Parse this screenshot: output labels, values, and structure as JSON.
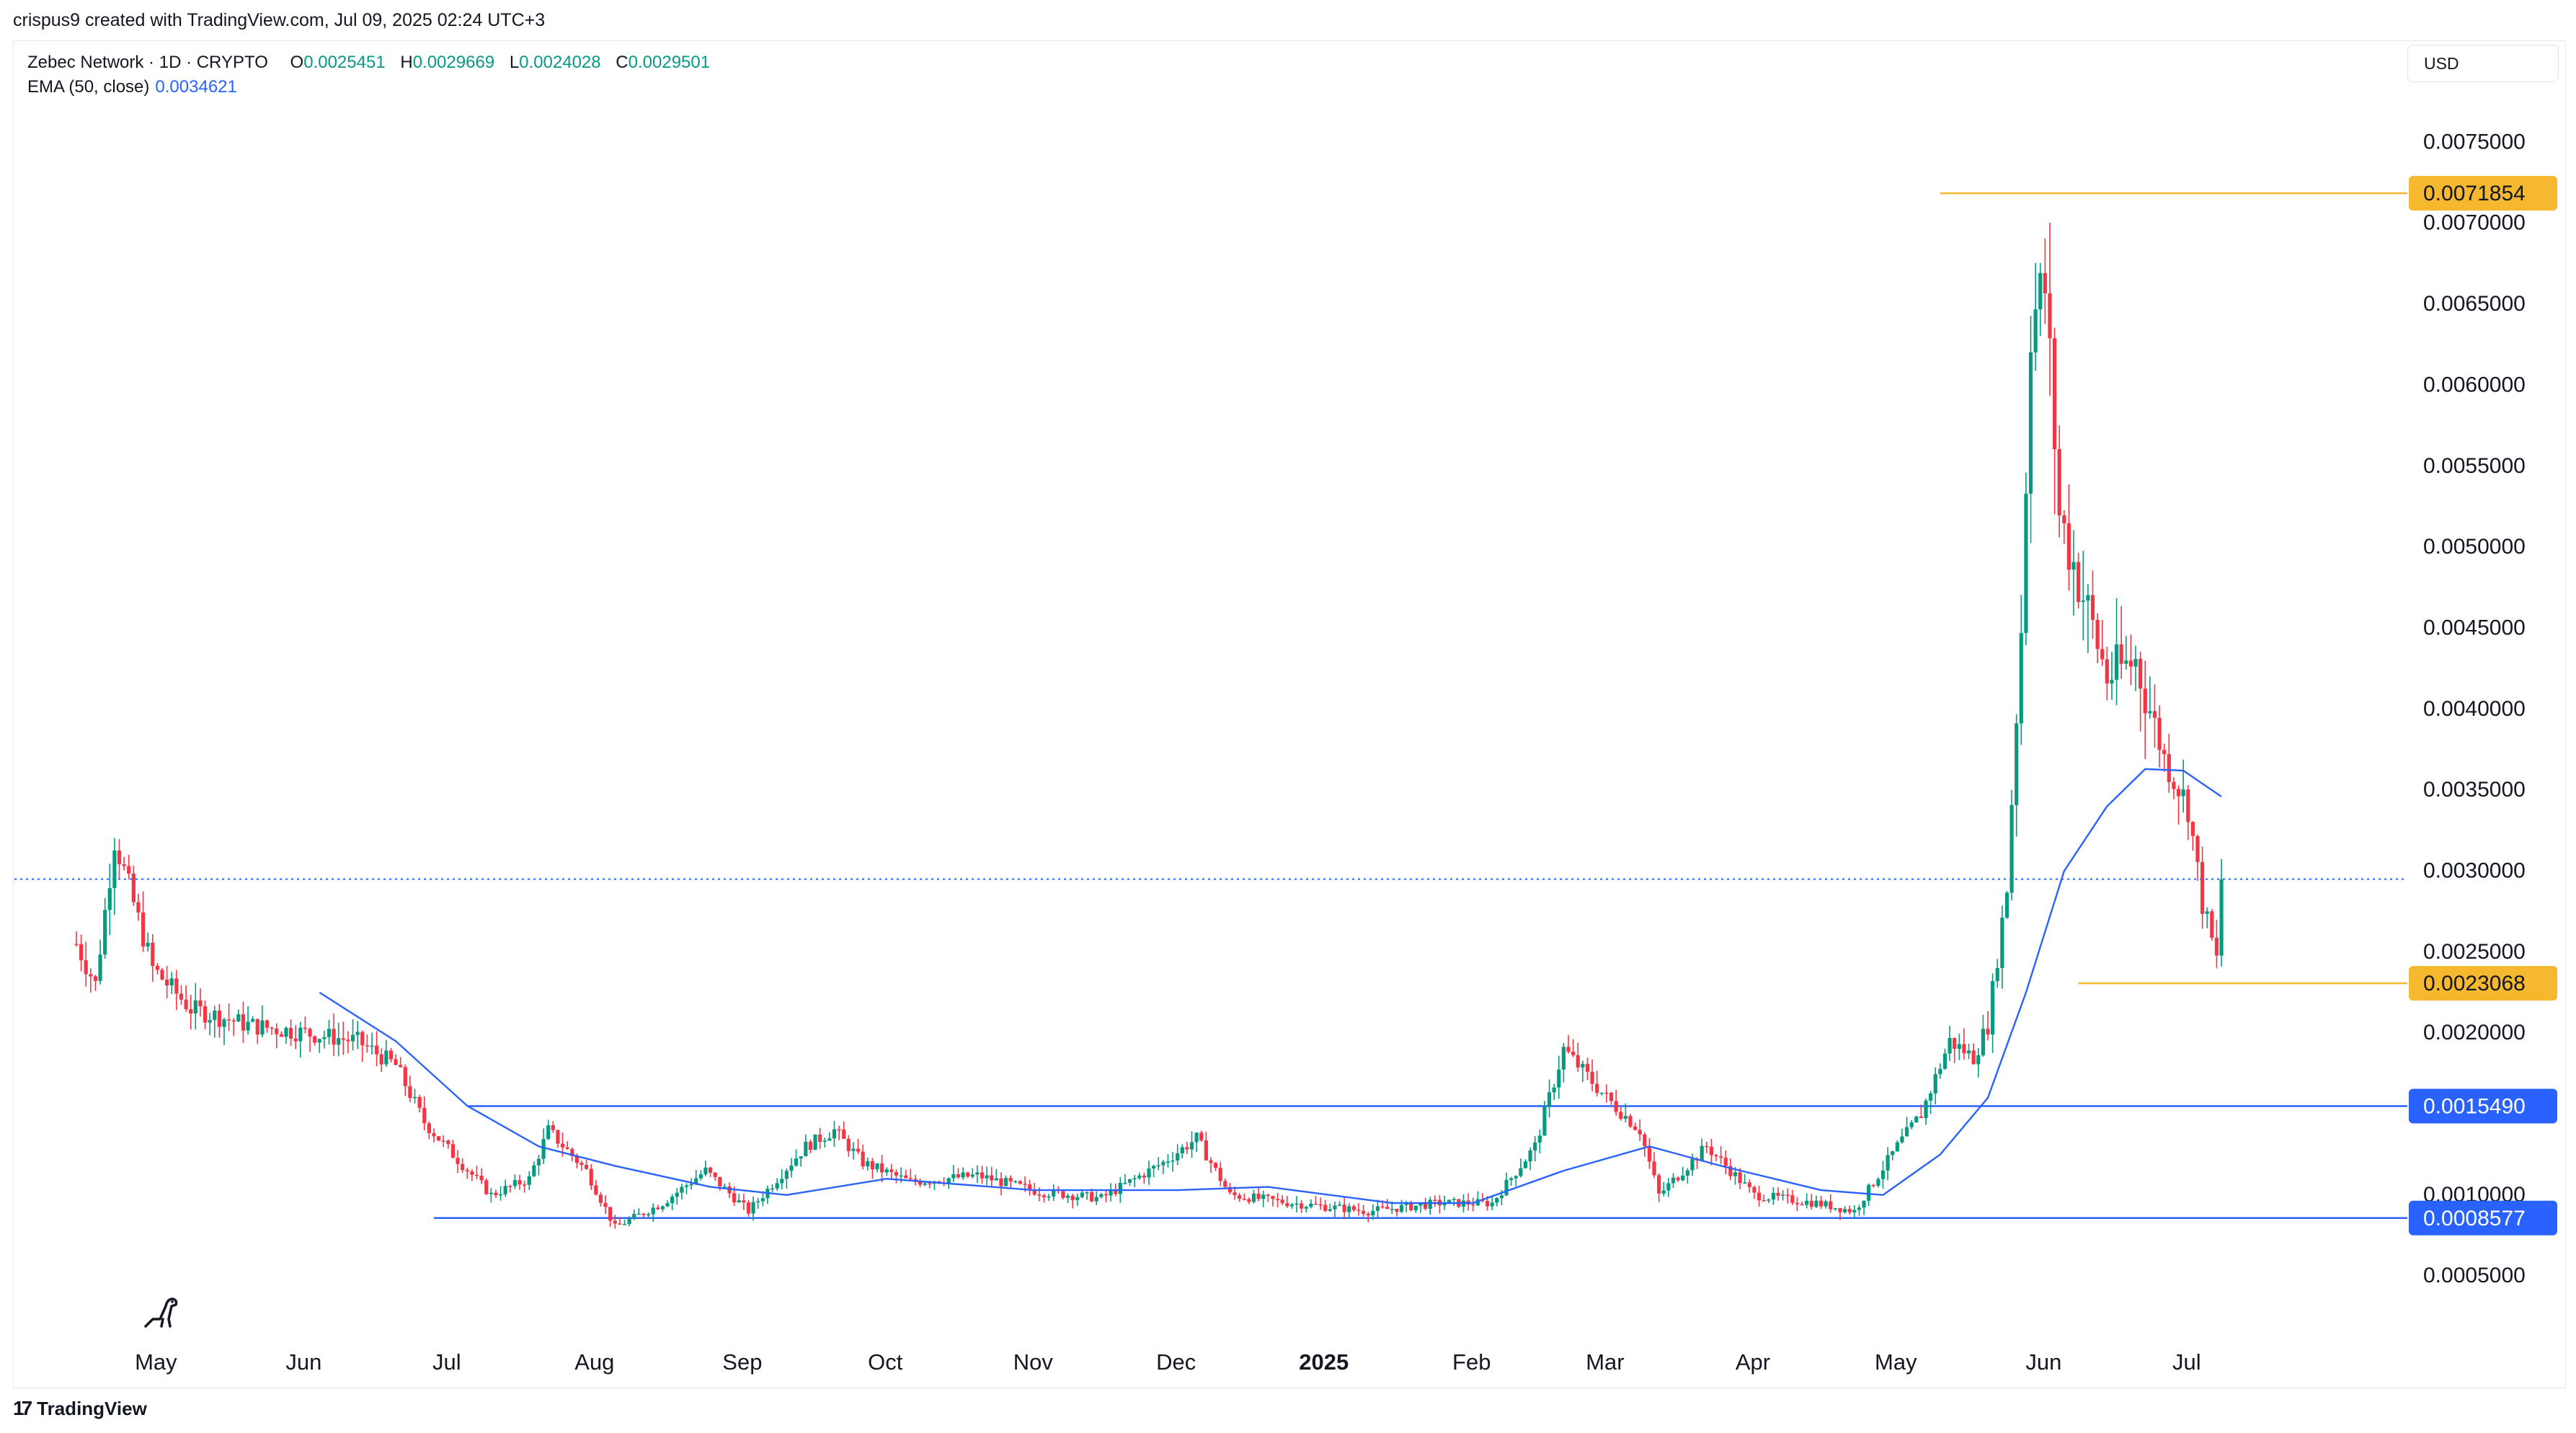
{
  "header": {
    "created_by": "crispus9 created with TradingView.com, Jul 09, 2025 02:24 UTC+3"
  },
  "legend": {
    "symbol": "Zebec Network · 1D · CRYPTO",
    "open_label": "O",
    "open": "0.0025451",
    "high_label": "H",
    "high": "0.0029669",
    "low_label": "L",
    "low": "0.0024028",
    "close_label": "C",
    "close": "0.0029501",
    "ema_label": "EMA (50, close)",
    "ema_value": "0.0034621"
  },
  "currency": "USD",
  "footer": {
    "brand": "TradingView",
    "brand_mark": "17"
  },
  "icons": {
    "dino": "dino-icon",
    "logo": "tradingview-logo-icon"
  },
  "colors": {
    "up": "#089981",
    "down": "#f23645",
    "ema": "#2962ff",
    "hline": "#2962ff",
    "highlow": "#f5b82e",
    "price_dotted": "#2962ff"
  },
  "chart_data": {
    "type": "candlestick",
    "title": "",
    "y_axis": {
      "ticks": [
        "0.0075000",
        "0.0070000",
        "0.0065000",
        "0.0060000",
        "0.0055000",
        "0.0050000",
        "0.0045000",
        "0.0040000",
        "0.0035000",
        "0.0030000",
        "0.0025000",
        "0.0020000",
        "0.0010000",
        "0.0005000"
      ],
      "ylim": [
        0.0001,
        0.0078
      ]
    },
    "x_axis": {
      "ticks": [
        "May",
        "Jun",
        "Jul",
        "Aug",
        "Sep",
        "Oct",
        "Nov",
        "Dec",
        "2025",
        "Feb",
        "Mar",
        "Apr",
        "May",
        "Jun",
        "Jul"
      ],
      "bold_tick": "2025",
      "range": [
        "2024-04-01",
        "2025-08-16"
      ]
    },
    "price_labels": [
      {
        "value": "0.0071854",
        "kind": "high"
      },
      {
        "value": "0.0023068",
        "kind": "low"
      },
      {
        "value": "0.0015490",
        "kind": "level"
      },
      {
        "value": "0.0008577",
        "kind": "level"
      }
    ],
    "horizontal_levels": [
      0.001549,
      0.0008577
    ],
    "high_marker": {
      "value": 0.0071854,
      "date": "2025-05-30"
    },
    "low_marker": {
      "value": 0.0023068,
      "date": "2025-07-07"
    },
    "last_price": 0.0029501,
    "price_path": [
      {
        "date": "2024-04-14",
        "close": 0.00255
      },
      {
        "date": "2024-04-18",
        "close": 0.0023
      },
      {
        "date": "2024-04-22",
        "close": 0.0032
      },
      {
        "date": "2024-04-25",
        "close": 0.0029
      },
      {
        "date": "2024-04-30",
        "close": 0.0024
      },
      {
        "date": "2024-05-08",
        "close": 0.00215
      },
      {
        "date": "2024-05-20",
        "close": 0.00205
      },
      {
        "date": "2024-06-01",
        "close": 0.002
      },
      {
        "date": "2024-06-12",
        "close": 0.00195
      },
      {
        "date": "2024-06-20",
        "close": 0.0018
      },
      {
        "date": "2024-06-26",
        "close": 0.00145
      },
      {
        "date": "2024-07-02",
        "close": 0.00125
      },
      {
        "date": "2024-07-10",
        "close": 0.001
      },
      {
        "date": "2024-07-18",
        "close": 0.0011
      },
      {
        "date": "2024-07-22",
        "close": 0.0014
      },
      {
        "date": "2024-07-30",
        "close": 0.00115
      },
      {
        "date": "2024-08-05",
        "close": 0.0008
      },
      {
        "date": "2024-08-15",
        "close": 0.00095
      },
      {
        "date": "2024-08-24",
        "close": 0.00115
      },
      {
        "date": "2024-09-02",
        "close": 0.0009
      },
      {
        "date": "2024-09-14",
        "close": 0.0013
      },
      {
        "date": "2024-09-20",
        "close": 0.0014
      },
      {
        "date": "2024-09-26",
        "close": 0.0012
      },
      {
        "date": "2024-10-06",
        "close": 0.00108
      },
      {
        "date": "2024-10-20",
        "close": 0.00112
      },
      {
        "date": "2024-11-02",
        "close": 0.00102
      },
      {
        "date": "2024-11-15",
        "close": 0.00098
      },
      {
        "date": "2024-11-28",
        "close": 0.0012
      },
      {
        "date": "2024-12-05",
        "close": 0.00135
      },
      {
        "date": "2024-12-12",
        "close": 0.001
      },
      {
        "date": "2024-12-25",
        "close": 0.00095
      },
      {
        "date": "2025-01-10",
        "close": 0.0009
      },
      {
        "date": "2025-01-25",
        "close": 0.00095
      },
      {
        "date": "2025-02-05",
        "close": 0.00095
      },
      {
        "date": "2025-02-14",
        "close": 0.0013
      },
      {
        "date": "2025-02-20",
        "close": 0.0019
      },
      {
        "date": "2025-03-01",
        "close": 0.0016
      },
      {
        "date": "2025-03-08",
        "close": 0.0014
      },
      {
        "date": "2025-03-12",
        "close": 0.001
      },
      {
        "date": "2025-03-22",
        "close": 0.0013
      },
      {
        "date": "2025-04-01",
        "close": 0.001
      },
      {
        "date": "2025-04-14",
        "close": 0.00095
      },
      {
        "date": "2025-04-22",
        "close": 0.0009
      },
      {
        "date": "2025-05-01",
        "close": 0.0013
      },
      {
        "date": "2025-05-06",
        "close": 0.0015
      },
      {
        "date": "2025-05-12",
        "close": 0.00195
      },
      {
        "date": "2025-05-17",
        "close": 0.00185
      },
      {
        "date": "2025-05-20",
        "close": 0.00205
      },
      {
        "date": "2025-05-24",
        "close": 0.0029
      },
      {
        "date": "2025-05-27",
        "close": 0.0045
      },
      {
        "date": "2025-05-29",
        "close": 0.0064
      },
      {
        "date": "2025-06-01",
        "close": 0.0066
      },
      {
        "date": "2025-06-04",
        "close": 0.0052
      },
      {
        "date": "2025-06-08",
        "close": 0.0048
      },
      {
        "date": "2025-06-14",
        "close": 0.0042
      },
      {
        "date": "2025-06-20",
        "close": 0.0043
      },
      {
        "date": "2025-06-26",
        "close": 0.0037
      },
      {
        "date": "2025-07-01",
        "close": 0.0034
      },
      {
        "date": "2025-07-04",
        "close": 0.0028
      },
      {
        "date": "2025-07-07",
        "close": 0.00245
      },
      {
        "date": "2025-07-08",
        "close": 0.00295
      }
    ],
    "ema_path": [
      {
        "date": "2024-06-04",
        "value": 0.00225
      },
      {
        "date": "2024-06-20",
        "value": 0.00195
      },
      {
        "date": "2024-07-05",
        "value": 0.00155
      },
      {
        "date": "2024-07-20",
        "value": 0.0013
      },
      {
        "date": "2024-08-05",
        "value": 0.00118
      },
      {
        "date": "2024-08-25",
        "value": 0.00105
      },
      {
        "date": "2024-09-10",
        "value": 0.001
      },
      {
        "date": "2024-10-01",
        "value": 0.0011
      },
      {
        "date": "2024-11-01",
        "value": 0.00103
      },
      {
        "date": "2024-12-01",
        "value": 0.00103
      },
      {
        "date": "2024-12-20",
        "value": 0.00105
      },
      {
        "date": "2025-01-15",
        "value": 0.00095
      },
      {
        "date": "2025-02-01",
        "value": 0.00095
      },
      {
        "date": "2025-02-20",
        "value": 0.00115
      },
      {
        "date": "2025-03-10",
        "value": 0.0013
      },
      {
        "date": "2025-03-25",
        "value": 0.00118
      },
      {
        "date": "2025-04-15",
        "value": 0.00103
      },
      {
        "date": "2025-04-28",
        "value": 0.001
      },
      {
        "date": "2025-05-10",
        "value": 0.00125
      },
      {
        "date": "2025-05-20",
        "value": 0.0016
      },
      {
        "date": "2025-05-28",
        "value": 0.00225
      },
      {
        "date": "2025-06-05",
        "value": 0.003
      },
      {
        "date": "2025-06-14",
        "value": 0.0034
      },
      {
        "date": "2025-06-22",
        "value": 0.00363
      },
      {
        "date": "2025-06-30",
        "value": 0.00362
      },
      {
        "date": "2025-07-08",
        "value": 0.00346
      }
    ]
  }
}
